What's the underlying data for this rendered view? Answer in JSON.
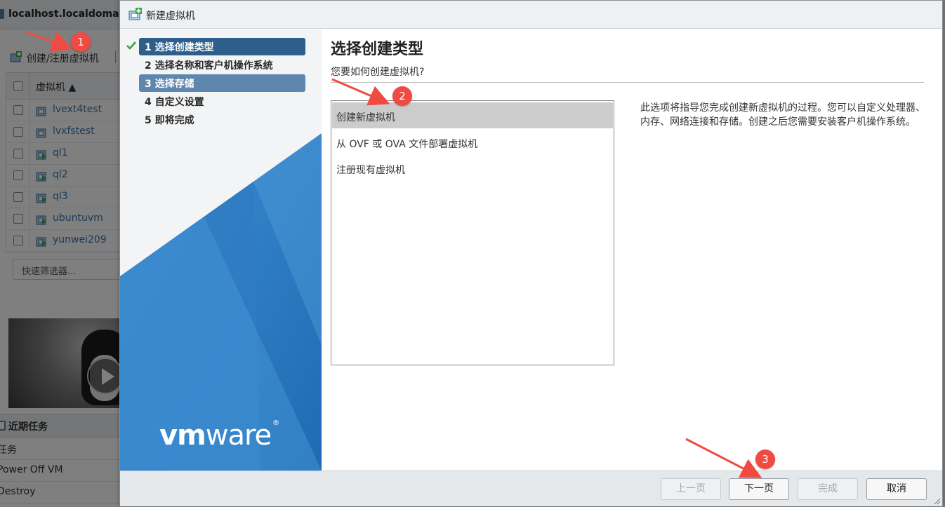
{
  "background": {
    "host_title": "localhost.localdomain",
    "toolbar": {
      "create_register_label": "创建/注册虚拟机"
    },
    "vm_table": {
      "column_header": "虚拟机 ▲",
      "rows": [
        {
          "name": "lvext4test",
          "state": "off"
        },
        {
          "name": "lvxfstest",
          "state": "off"
        },
        {
          "name": "ql1",
          "state": "on"
        },
        {
          "name": "ql2",
          "state": "on"
        },
        {
          "name": "ql3",
          "state": "on"
        },
        {
          "name": "ubuntuvm",
          "state": "on"
        },
        {
          "name": "yunwei209",
          "state": "on"
        }
      ]
    },
    "filter_placeholder": "快速筛选器...",
    "recent_tasks": {
      "title": "近期任务",
      "rows": [
        "任务",
        "Power Off VM",
        "Destroy"
      ]
    }
  },
  "dialog": {
    "title": "新建虚拟机",
    "steps": [
      {
        "label": "1 选择创建类型",
        "state": "active",
        "completed": true
      },
      {
        "label": "2 选择名称和客户机操作系统",
        "state": "normal",
        "completed": false
      },
      {
        "label": "3 选择存储",
        "state": "visited",
        "completed": false
      },
      {
        "label": "4 自定义设置",
        "state": "normal",
        "completed": false
      },
      {
        "label": "5 即将完成",
        "state": "normal",
        "completed": false
      }
    ],
    "brand": {
      "bold": "vm",
      "light": "ware",
      "reg": "®"
    },
    "page": {
      "heading": "选择创建类型",
      "subheading": "您要如何创建虚拟机?",
      "options": [
        {
          "label": "创建新虚拟机",
          "selected": true
        },
        {
          "label": "从 OVF 或 OVA 文件部署虚拟机",
          "selected": false
        },
        {
          "label": "注册现有虚拟机",
          "selected": false
        }
      ],
      "description": "此选项将指导您完成创建新虚拟机的过程。您可以自定义处理器、内存、网络连接和存储。创建之后您需要安装客户机操作系统。"
    },
    "buttons": {
      "back": {
        "label": "上一页",
        "enabled": false
      },
      "next": {
        "label": "下一页",
        "enabled": true
      },
      "finish": {
        "label": "完成",
        "enabled": false
      },
      "cancel": {
        "label": "取消",
        "enabled": true
      }
    }
  },
  "annotations": [
    "1",
    "2",
    "3"
  ],
  "colors": {
    "step_active": "#2e5f8a",
    "step_visited": "#5f86ad",
    "badge": "#f04b43",
    "vmware_blue": "#2d7fc4"
  }
}
